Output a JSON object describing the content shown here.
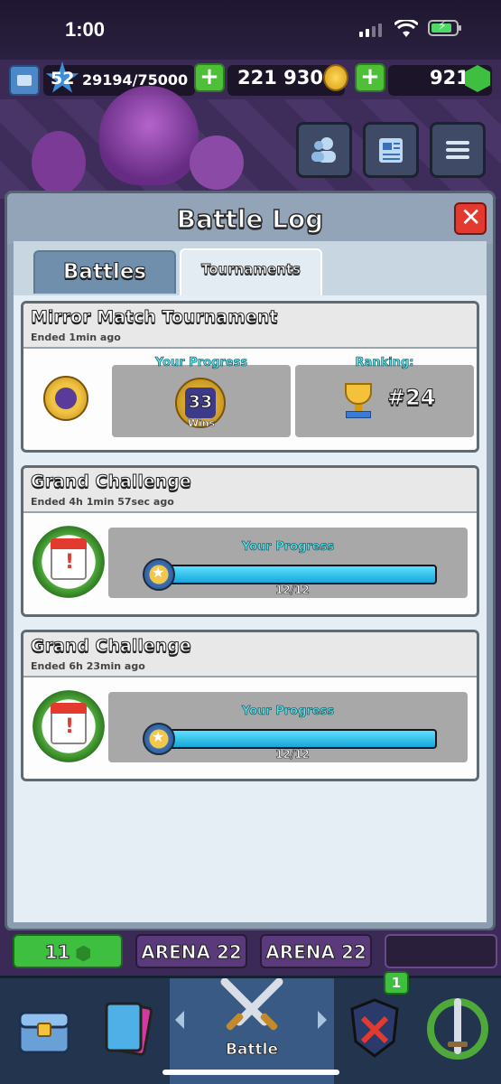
{
  "status_bar": {
    "time": "1:00"
  },
  "resources": {
    "level": "52",
    "xp": "29194/75000",
    "gold": "221 930",
    "gems": "921"
  },
  "modal": {
    "title": "Battle Log",
    "tabs": [
      {
        "label": "Battles",
        "active": false
      },
      {
        "label": "Tournaments",
        "active": true
      }
    ]
  },
  "entries": [
    {
      "title": "Mirror Match Tournament",
      "subtitle": "Ended 1min ago",
      "progress_label": "Your Progress",
      "wins_value": "33",
      "wins_label": "Wins",
      "ranking_label": "Ranking:",
      "rank": "#24"
    },
    {
      "title": "Grand Challenge",
      "subtitle": "Ended 4h 1min  57sec ago",
      "progress_label": "Your Progress",
      "progress_text": "12/12",
      "progress_fraction": 1.0
    },
    {
      "title": "Grand Challenge",
      "subtitle": "Ended 6h 23min ago",
      "progress_label": "Your Progress",
      "progress_text": "12/12",
      "progress_fraction": 1.0
    }
  ],
  "bottom": {
    "chip_gems": "11",
    "arena_1": "ARENA 22",
    "arena_2": "ARENA 22",
    "active_nav_label": "Battle",
    "notification_count": "1"
  },
  "colors": {
    "accent_cyan": "#4ee6f0",
    "close_red": "#e23a2e",
    "plus_green": "#4fbf3a"
  }
}
